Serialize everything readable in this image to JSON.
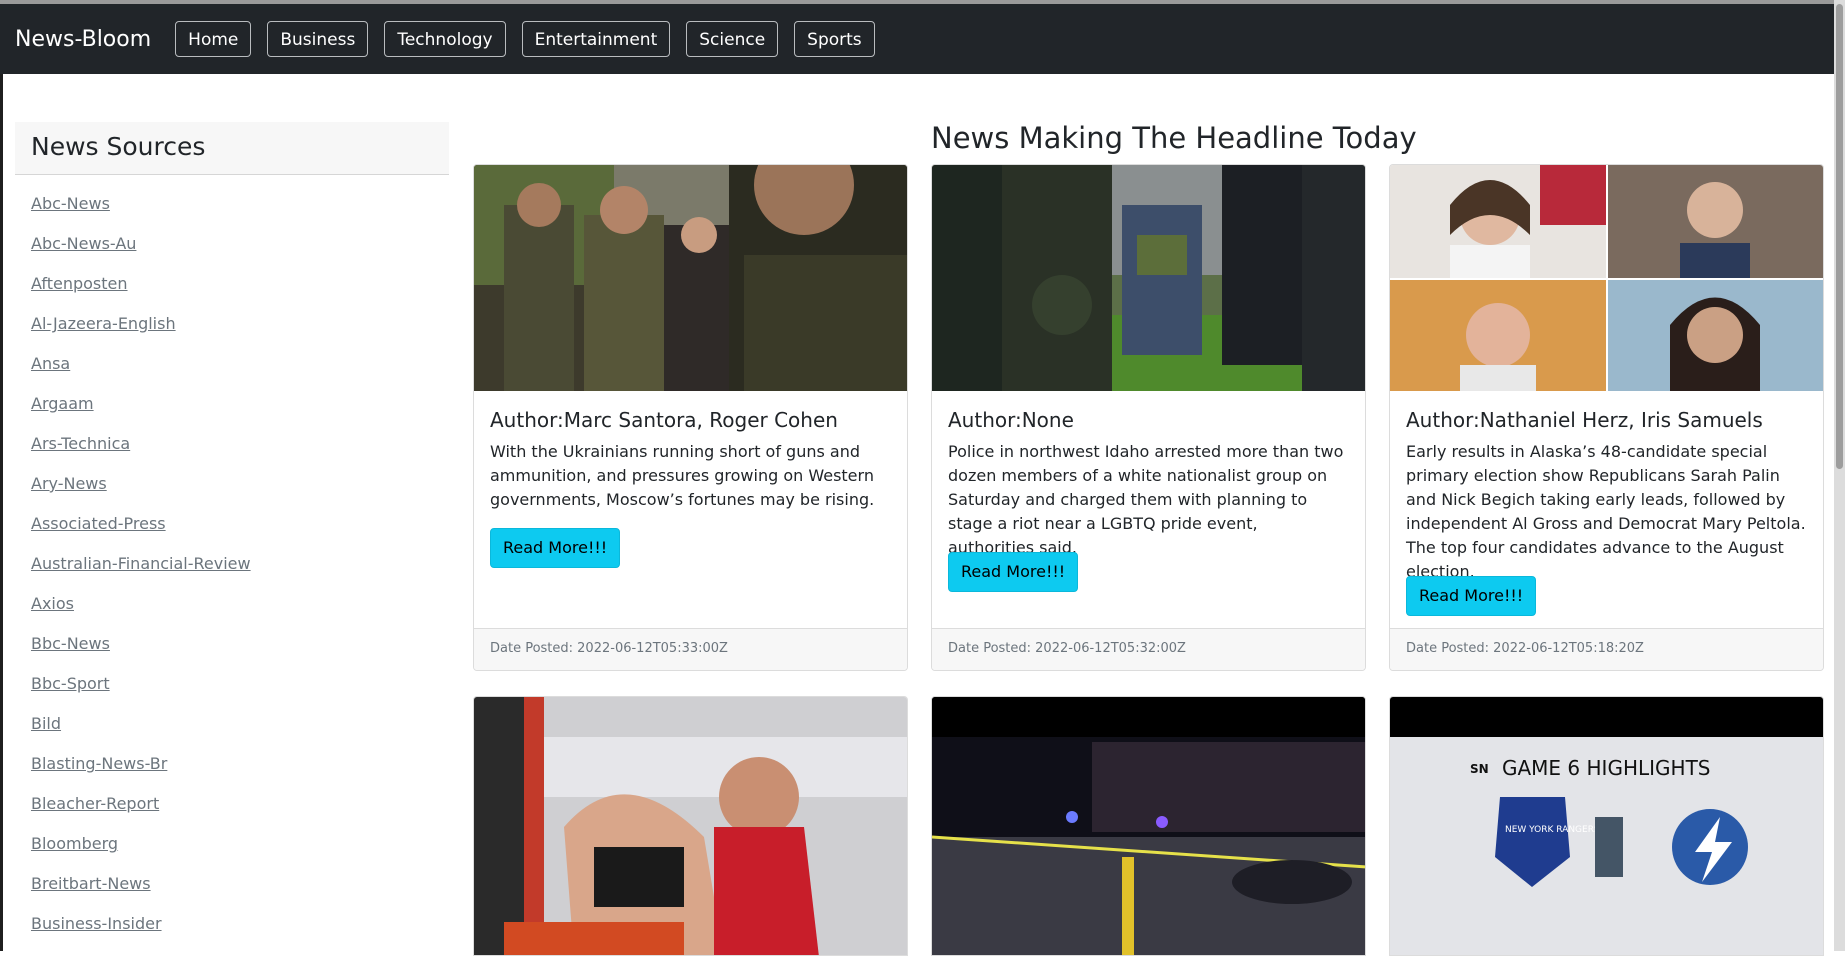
{
  "navbar": {
    "brand": "News-Bloom",
    "items": [
      {
        "label": "Home"
      },
      {
        "label": "Business"
      },
      {
        "label": "Technology"
      },
      {
        "label": "Entertainment"
      },
      {
        "label": "Science"
      },
      {
        "label": "Sports"
      }
    ]
  },
  "sidebar": {
    "title": "News Sources",
    "sources": [
      "Abc-News",
      "Abc-News-Au",
      "Aftenposten",
      "Al-Jazeera-English",
      "Ansa",
      "Argaam",
      "Ars-Technica",
      "Ary-News",
      "Associated-Press",
      "Australian-Financial-Review",
      "Axios",
      "Bbc-News",
      "Bbc-Sport",
      "Bild",
      "Blasting-News-Br",
      "Bleacher-Report",
      "Bloomberg",
      "Breitbart-News",
      "Business-Insider"
    ]
  },
  "main": {
    "headline": "News Making The Headline Today",
    "articles": [
      {
        "author": "Author:Marc Santora, Roger Cohen",
        "description": "With the Ukrainians running short of guns and ammunition, and pressures growing on Western governments, Moscow’s fortunes may be rising.",
        "button": "Read More!!!",
        "date": "Date Posted: 2022-06-12T05:33:00Z"
      },
      {
        "author": "Author:None",
        "description": "Police in northwest Idaho arrested more than two dozen members of a white nationalist group on Saturday and charged them with planning to stage a riot near a LGBTQ pride event, authorities said.",
        "button": "Read More!!!",
        "date": "Date Posted: 2022-06-12T05:32:00Z"
      },
      {
        "author": "Author:Nathaniel Herz, Iris Samuels",
        "description": "Early results in Alaska’s 48-candidate special primary election show Republicans Sarah Palin and Nick Begich taking early leads, followed by independent Al Gross and Democrat Mary Peltola. The top four candidates advance to the August election.",
        "button": "Read More!!!",
        "date": "Date Posted: 2022-06-12T05:18:20Z"
      }
    ],
    "second_row_overlay": {
      "game_label": "GAME 6 HIGHLIGHTS",
      "network": "SN",
      "team_left": "NEW YORK RANGERS"
    }
  }
}
